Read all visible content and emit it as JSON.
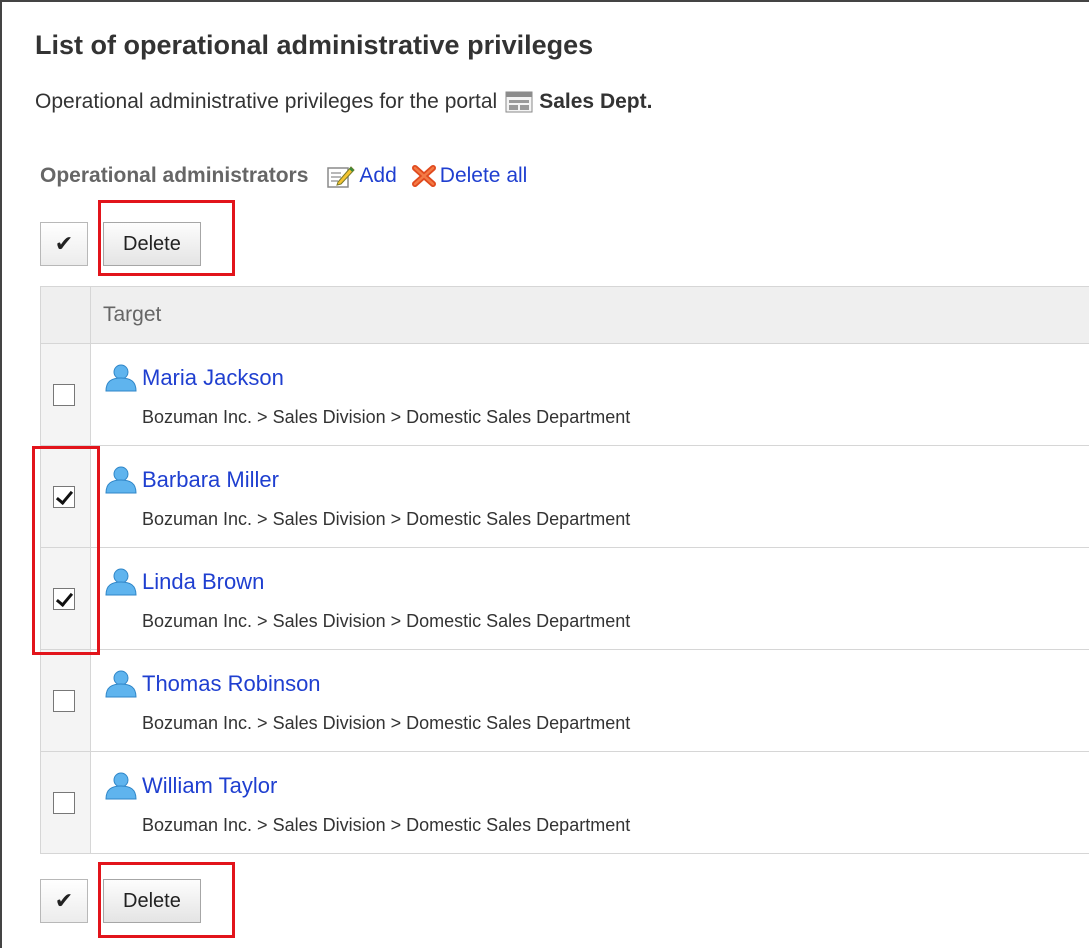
{
  "title": "List of operational administrative privileges",
  "subtitle": {
    "text": "Operational administrative privileges for the portal",
    "portal_name": "Sales Dept.",
    "portal_icon": "portal-icon"
  },
  "section": {
    "title": "Operational administrators",
    "add_label": "Add",
    "delete_all_label": "Delete all"
  },
  "toolbar": {
    "select_all_glyph": "✔",
    "delete_label": "Delete"
  },
  "table": {
    "header_target": "Target",
    "rows": [
      {
        "name": "Maria Jackson",
        "path": "Bozuman Inc. > Sales Division > Domestic Sales Department",
        "checked": false
      },
      {
        "name": "Barbara Miller",
        "path": "Bozuman Inc. > Sales Division > Domestic Sales Department",
        "checked": true
      },
      {
        "name": "Linda Brown",
        "path": "Bozuman Inc. > Sales Division > Domestic Sales Department",
        "checked": true
      },
      {
        "name": "Thomas Robinson",
        "path": "Bozuman Inc. > Sales Division > Domestic Sales Department",
        "checked": false
      },
      {
        "name": "William Taylor",
        "path": "Bozuman Inc. > Sales Division > Domestic Sales Department",
        "checked": false
      }
    ]
  },
  "colors": {
    "link": "#1f3fd0",
    "highlight": "#e2141b",
    "user_icon": "#3f9fe0"
  }
}
